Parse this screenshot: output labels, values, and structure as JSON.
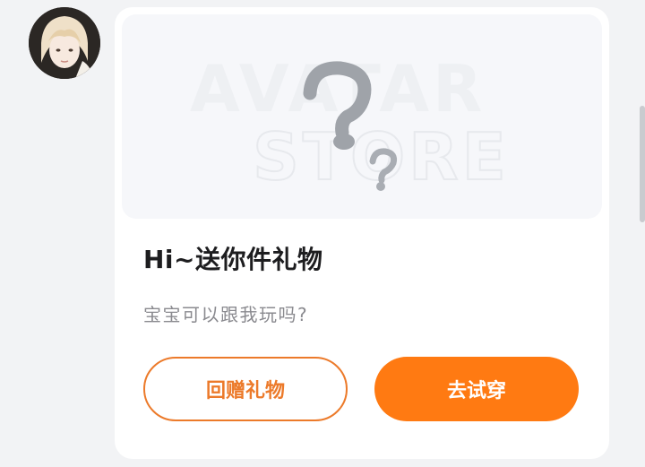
{
  "message": {
    "banner": {
      "watermark_line1": "AVATAR",
      "watermark_line2": "STORE",
      "placeholder_icon": "question-mark-icon"
    },
    "title": "Hi~送你件礼物",
    "subtitle": "宝宝可以跟我玩吗?",
    "buttons": {
      "return_gift": "回赠礼物",
      "try_on": "去试穿"
    }
  },
  "colors": {
    "accent": "#ff7a12",
    "outline": "#ec7a2a",
    "title": "#1d1d1f",
    "subtitle": "#8a8a8f",
    "background": "#f2f3f5"
  }
}
